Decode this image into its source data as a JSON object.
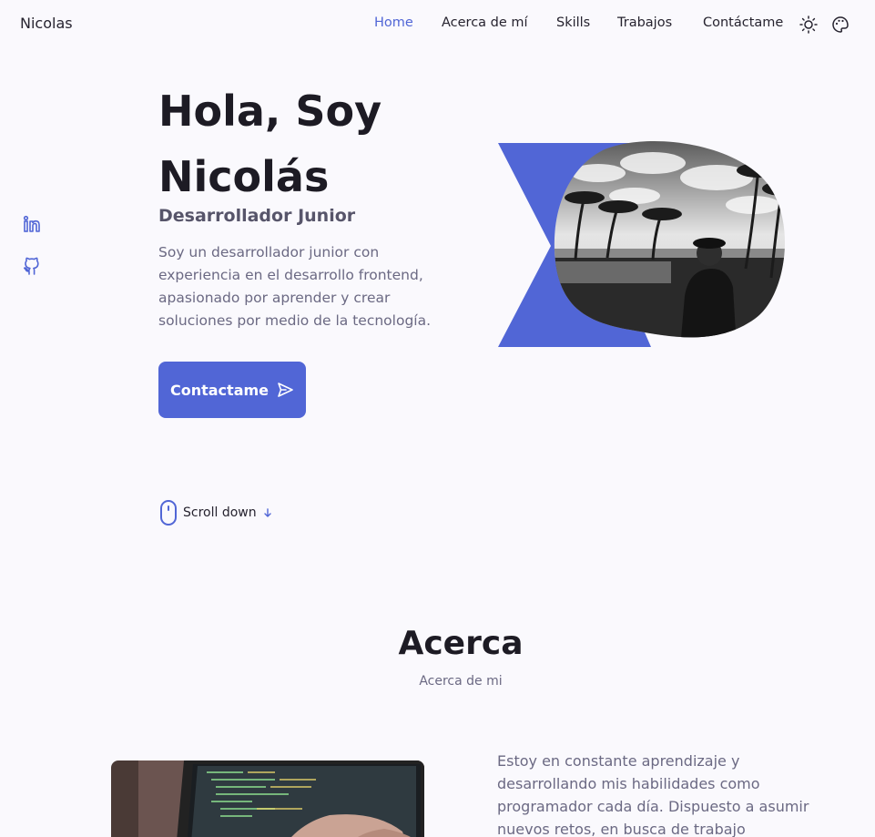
{
  "header": {
    "logo": "Nicolas",
    "nav": [
      {
        "label": "Home",
        "active": true
      },
      {
        "label": "Acerca de mí",
        "active": false
      },
      {
        "label": "Skills",
        "active": false
      },
      {
        "label": "Trabajos",
        "active": false
      },
      {
        "label": "Contáctame",
        "active": false
      }
    ],
    "theme_icon": "sun-icon",
    "palette_icon": "palette-icon"
  },
  "social": [
    {
      "icon": "linkedin-icon"
    },
    {
      "icon": "github-icon"
    }
  ],
  "hero": {
    "title": "Hola, Soy Nicolás",
    "subtitle": "Desarrollador Junior",
    "description": "Soy un desarrollador junior con experiencia en el desarrollo frontend, apasionado por aprender y crear soluciones por medio de la tecnología.",
    "cta_label": "Contactame",
    "scroll_label": "Scroll down"
  },
  "about": {
    "title": "Acerca",
    "subtitle": "Acerca de mi",
    "text": "Estoy en constante aprendizaje y desarrollando mis habilidades como programador cada día. Dispuesto a asumir nuevos retos, en busca de trabajo"
  },
  "colors": {
    "accent": "#5166d6",
    "background": "#faf9fd",
    "text": "#1d1b24",
    "muted": "#6b6983"
  }
}
